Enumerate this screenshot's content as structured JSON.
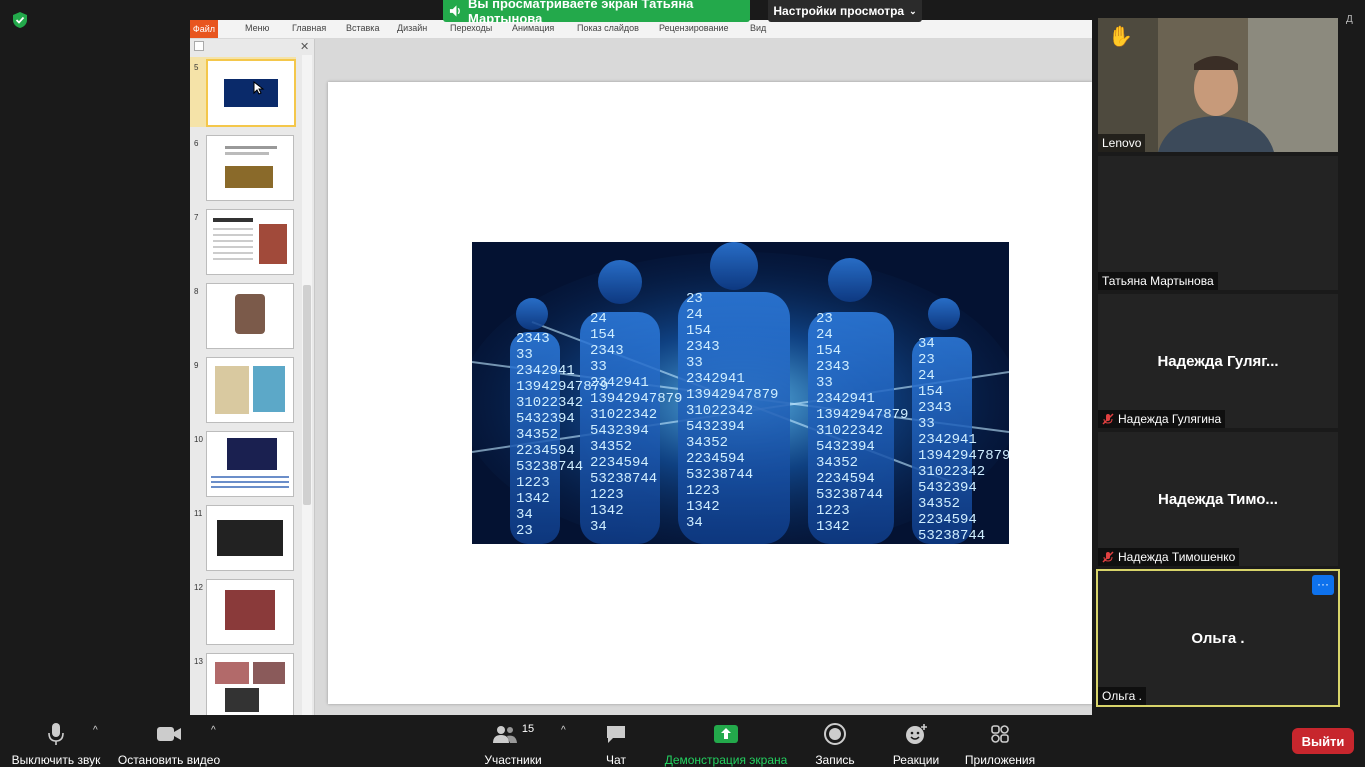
{
  "share_banner": {
    "text": "Вы просматриваете экран Татьяна Мартынова"
  },
  "view_options": {
    "label": "Настройки просмотра"
  },
  "ribbon": {
    "tabs": [
      "Файл",
      "Меню",
      "Главная",
      "Вставка",
      "Дизайн",
      "Переходы",
      "Анимация",
      "Показ слайдов",
      "Рецензирование",
      "Вид"
    ]
  },
  "slides": [
    {
      "num": "5"
    },
    {
      "num": "6"
    },
    {
      "num": "7"
    },
    {
      "num": "8"
    },
    {
      "num": "9"
    },
    {
      "num": "10"
    },
    {
      "num": "11"
    },
    {
      "num": "12"
    },
    {
      "num": "13"
    }
  ],
  "slide_image_digits": [
    "2343",
    "33",
    "2342941",
    "13942947879",
    "31022342",
    "5432394",
    "34352",
    "2234594",
    "53238744",
    "1223",
    "1342",
    "34",
    "23",
    "24",
    "154"
  ],
  "participants": {
    "lenovo": {
      "name": "Lenovo"
    },
    "tatiana": {
      "name": "Татьяна Мартынова"
    },
    "nadezhda_g": {
      "display": "Надежда Гуляг...",
      "name": "Надежда Гулягина"
    },
    "nadezhda_t": {
      "display": "Надежда Тимо...",
      "name": "Надежда Тимошенко"
    },
    "olga": {
      "display": "Ольга .",
      "name": "Ольга ."
    }
  },
  "edge_label": "Д",
  "toolbar": {
    "mute_label": "Выключить звук",
    "video_label": "Остановить видео",
    "participants_label": "Участники",
    "participants_count": "15",
    "chat_label": "Чат",
    "share_label": "Демонстрация экрана",
    "record_label": "Запись",
    "reactions_label": "Реакции",
    "apps_label": "Приложения",
    "leave_label": "Выйти"
  },
  "colors": {
    "share_green": "#23a94b",
    "leave_red": "#c7262d",
    "active_border": "#d8d46a",
    "file_tab": "#e8551e"
  }
}
